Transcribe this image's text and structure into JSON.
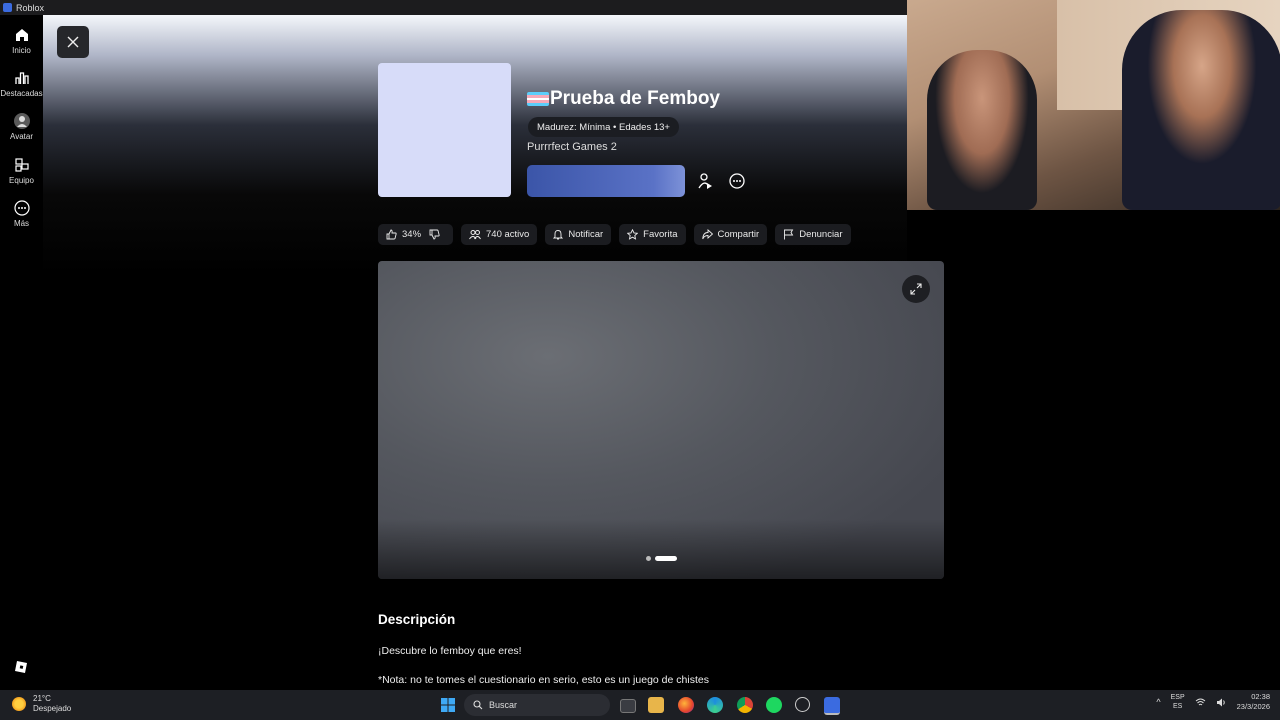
{
  "window": {
    "title": "Roblox"
  },
  "sidebar": {
    "items": [
      {
        "label": "Inicio",
        "icon": "home-icon"
      },
      {
        "label": "Destacadas",
        "icon": "charts-icon"
      },
      {
        "label": "Avatar",
        "icon": "avatar-icon"
      },
      {
        "label": "Equipo",
        "icon": "inventory-icon"
      },
      {
        "label": "Más",
        "icon": "more-icon"
      }
    ]
  },
  "game": {
    "title": "Prueba de Femboy",
    "maturity": "Madurez: Mínima • Edades 13+",
    "creator": "Purrrfect Games 2",
    "thumbnail_color": "#d7dcf9",
    "play_color": "#4a62b8"
  },
  "actions": {
    "rating": "34%",
    "active": "740 activo",
    "notify": "Notificar",
    "favorite": "Favorita",
    "share": "Compartir",
    "report": "Denunciar"
  },
  "media": {
    "slides": 2,
    "active_slide": 2
  },
  "description": {
    "heading": "Descripción",
    "lines": [
      "¡Descubre lo femboy que eres!",
      "*Nota: no te tomes el cuestionario en serio, esto es un juego de chistes"
    ]
  },
  "taskbar": {
    "weather_temp": "21°C",
    "weather_desc": "Despejado",
    "search_placeholder": "Buscar",
    "lang_top": "ESP",
    "lang_bottom": "ES",
    "time": "02:38",
    "date": "23/3/2026"
  }
}
